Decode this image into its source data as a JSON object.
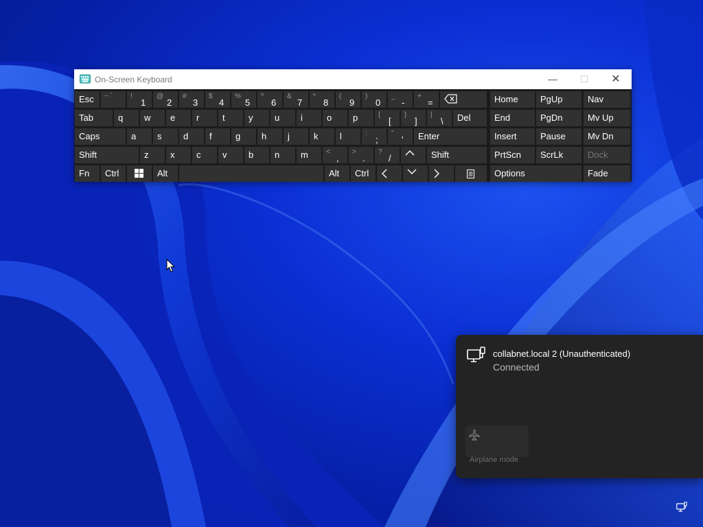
{
  "window": {
    "title": "On-Screen Keyboard",
    "minimize": "—",
    "maximize": "☐",
    "close": "✕"
  },
  "keyboard": {
    "row1": {
      "esc": "Esc",
      "backtick": {
        "shift": "~ `"
      },
      "k1": {
        "shift": "!",
        "main": "1"
      },
      "k2": {
        "shift": "@",
        "main": "2"
      },
      "k3": {
        "shift": "#",
        "main": "3"
      },
      "k4": {
        "shift": "$",
        "main": "4"
      },
      "k5": {
        "shift": "%",
        "main": "5"
      },
      "k6": {
        "shift": "^",
        "main": "6"
      },
      "k7": {
        "shift": "&",
        "main": "7"
      },
      "k8": {
        "shift": "*",
        "main": "8"
      },
      "k9": {
        "shift": "(",
        "main": "9"
      },
      "k0": {
        "shift": ")",
        "main": "0"
      },
      "minus": {
        "shift": "_",
        "main": "-"
      },
      "equals": {
        "shift": "+",
        "main": "="
      },
      "home": "Home",
      "pgup": "PgUp",
      "nav": "Nav"
    },
    "row2": {
      "tab": "Tab",
      "letters": [
        "q",
        "w",
        "e",
        "r",
        "t",
        "y",
        "u",
        "i",
        "o",
        "p"
      ],
      "lbracket": {
        "shift": "{",
        "main": "["
      },
      "rbracket": {
        "shift": "}",
        "main": "]"
      },
      "backslash": {
        "shift": "|",
        "main": "\\"
      },
      "del": "Del",
      "end": "End",
      "pgdn": "PgDn",
      "mvup": "Mv Up"
    },
    "row3": {
      "caps": "Caps",
      "letters": [
        "a",
        "s",
        "d",
        "f",
        "g",
        "h",
        "j",
        "k",
        "l"
      ],
      "semicolon": {
        "shift": ":",
        "main": ";"
      },
      "quote": {
        "shift": "\"",
        "main": "'"
      },
      "enter": "Enter",
      "insert": "Insert",
      "pause": "Pause",
      "mvdn": "Mv Dn"
    },
    "row4": {
      "lshift": "Shift",
      "letters": [
        "z",
        "x",
        "c",
        "v",
        "b",
        "n",
        "m"
      ],
      "comma": {
        "shift": "<",
        "main": ","
      },
      "period": {
        "shift": ">",
        "main": "."
      },
      "slash": {
        "shift": "?",
        "main": "/"
      },
      "rshift": "Shift",
      "prtscn": "PrtScn",
      "scrlk": "ScrLk",
      "dock": "Dock"
    },
    "row5": {
      "fn": "Fn",
      "lctrl": "Ctrl",
      "lalt": "Alt",
      "ralt": "Alt",
      "rctrl": "Ctrl",
      "options": "Options",
      "fade": "Fade"
    }
  },
  "network": {
    "name": "collabnet.local 2 (Unauthenticated)",
    "status": "Connected",
    "airplane_label": "Airplane mode"
  },
  "colors": {
    "key_bg": "#313131",
    "window_bg": "#1b1b1b",
    "flyout_bg": "#232323",
    "wallpaper_blue": "#0b2fd4"
  },
  "icons": [
    "keyboard-app-icon",
    "backspace-icon",
    "windows-icon",
    "arrow-up-icon",
    "arrow-left-icon",
    "arrow-down-icon",
    "arrow-right-icon",
    "menu-icon",
    "ethernet-icon",
    "airplane-icon",
    "network-tray-icon",
    "mouse-cursor-icon"
  ]
}
